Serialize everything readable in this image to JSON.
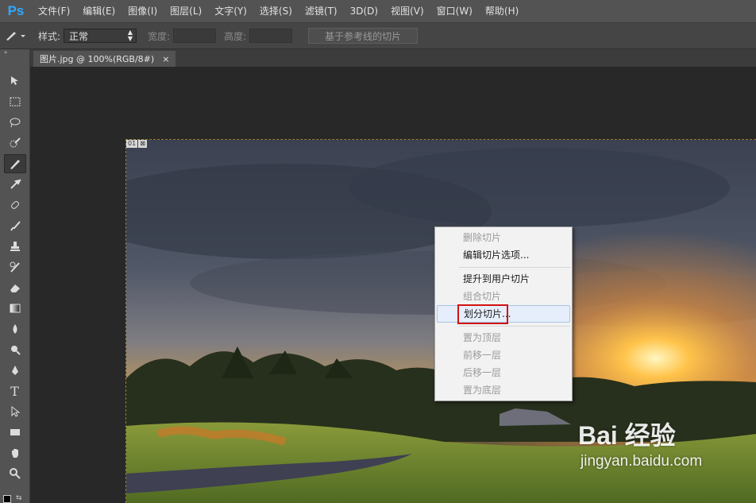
{
  "app": {
    "logo": "Ps"
  },
  "menu": [
    "文件(F)",
    "编辑(E)",
    "图像(I)",
    "图层(L)",
    "文字(Y)",
    "选择(S)",
    "滤镜(T)",
    "3D(D)",
    "视图(V)",
    "窗口(W)",
    "帮助(H)"
  ],
  "options_bar": {
    "tool_icon": "slice-tool-icon",
    "style_label": "样式:",
    "style_value": "正常",
    "width_label": "宽度:",
    "height_label": "高度:",
    "guides_button": "基于参考线的切片"
  },
  "document": {
    "tab_title": "图片.jpg @ 100%(RGB/8#)",
    "close_glyph": "×",
    "slice_number": "01",
    "slice_icon": "⊠"
  },
  "context_menu": {
    "items": [
      {
        "label": "删除切片",
        "enabled": false
      },
      {
        "label": "编辑切片选项...",
        "enabled": true
      },
      {
        "label": "提升到用户切片",
        "enabled": true
      },
      {
        "label": "组合切片",
        "enabled": false
      },
      {
        "label": "划分切片...",
        "enabled": true,
        "highlighted": true
      },
      {
        "label": "置为顶层",
        "enabled": false
      },
      {
        "label": "前移一层",
        "enabled": false
      },
      {
        "label": "后移一层",
        "enabled": false
      },
      {
        "label": "置为底层",
        "enabled": false
      }
    ]
  },
  "watermark": {
    "logo_text": "Bai 经验",
    "url": "jingyan.baidu.com"
  },
  "colors": {
    "ps_blue": "#31a8ff",
    "annotation_red": "#d31212",
    "menu_highlight": "#e6eefb"
  }
}
